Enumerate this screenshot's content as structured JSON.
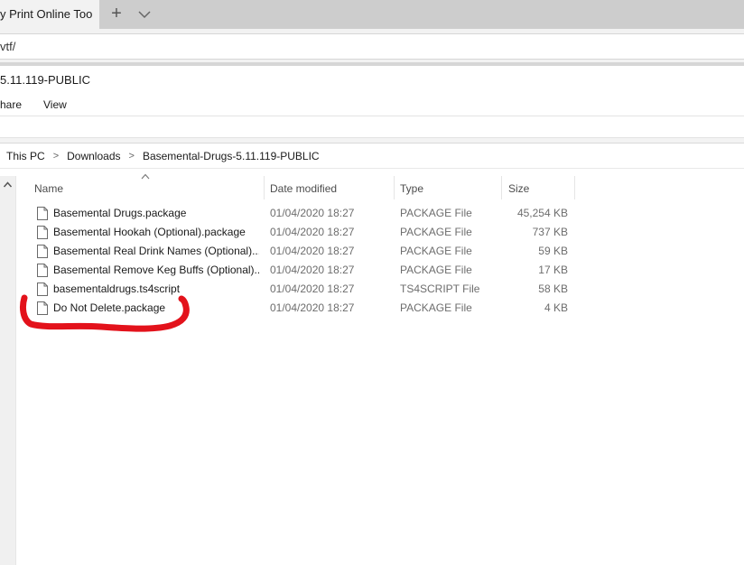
{
  "browser": {
    "tab_title": "y Print Online Too",
    "new_tab_symbol": "+",
    "address_text": "vtf/"
  },
  "explorer": {
    "window_title": "5.11.119-PUBLIC",
    "menu": {
      "share": "hare",
      "view": "View"
    },
    "breadcrumb": [
      "This PC",
      "Downloads",
      "Basemental-Drugs-5.11.119-PUBLIC"
    ],
    "breadcrumb_separator": ">",
    "columns": {
      "name": "Name",
      "date": "Date modified",
      "type": "Type",
      "size": "Size"
    },
    "files": [
      {
        "name": "Basemental Drugs.package",
        "date": "01/04/2020 18:27",
        "type": "PACKAGE File",
        "size": "45,254 KB"
      },
      {
        "name": "Basemental Hookah (Optional).package",
        "date": "01/04/2020 18:27",
        "type": "PACKAGE File",
        "size": "737 KB"
      },
      {
        "name": "Basemental Real Drink Names (Optional)....",
        "date": "01/04/2020 18:27",
        "type": "PACKAGE File",
        "size": "59 KB"
      },
      {
        "name": "Basemental Remove Keg Buffs (Optional)...",
        "date": "01/04/2020 18:27",
        "type": "PACKAGE File",
        "size": "17 KB"
      },
      {
        "name": "basementaldrugs.ts4script",
        "date": "01/04/2020 18:27",
        "type": "TS4SCRIPT File",
        "size": "58 KB"
      },
      {
        "name": "Do Not Delete.package",
        "date": "01/04/2020 18:27",
        "type": "PACKAGE File",
        "size": "4 KB"
      }
    ]
  },
  "colors": {
    "annotation": "#e3121b",
    "tabstrip": "#cdcdcd",
    "muted_text": "#6d6d6d"
  },
  "icons": [
    "tab-list-chevron-icon",
    "scroll-up-icon",
    "sort-ascending-icon",
    "file-icon"
  ]
}
